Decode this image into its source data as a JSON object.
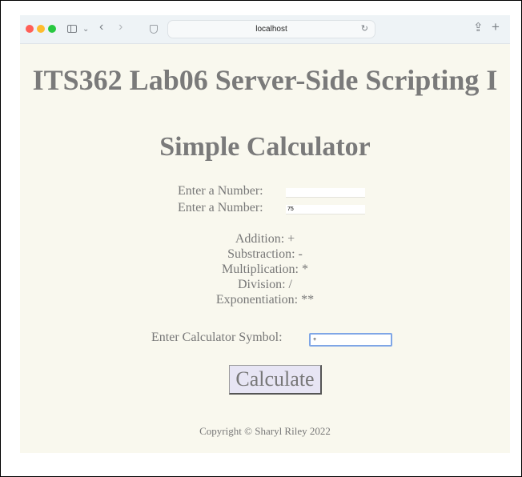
{
  "browser": {
    "address": "localhost",
    "icons": [
      "sidebar-icon",
      "chevron-down-icon",
      "back-icon",
      "forward-icon",
      "shield-icon",
      "reload-icon",
      "share-icon",
      "plus-icon"
    ]
  },
  "page": {
    "title": "ITS362 Lab06 Server-Side Scripting I",
    "subtitle": "Simple Calculator",
    "number1_label": "Enter a Number:",
    "number1_value": "",
    "number2_label": "Enter a Number:",
    "number2_value": "75",
    "operations": [
      "Addition: +",
      "Substraction: -",
      "Multiplication: *",
      "Division: /",
      "Exponentiation: **"
    ],
    "symbol_label": "Enter Calculator Symbol:",
    "symbol_value": "+",
    "calculate_label": "Calculate",
    "copyright": "Copyright © Sharyl Riley 2022"
  },
  "colors": {
    "page_background": "#f9f8ee",
    "text": "#777777",
    "button_background": "#e7e5f4",
    "focus_border": "#7fa6e6"
  }
}
